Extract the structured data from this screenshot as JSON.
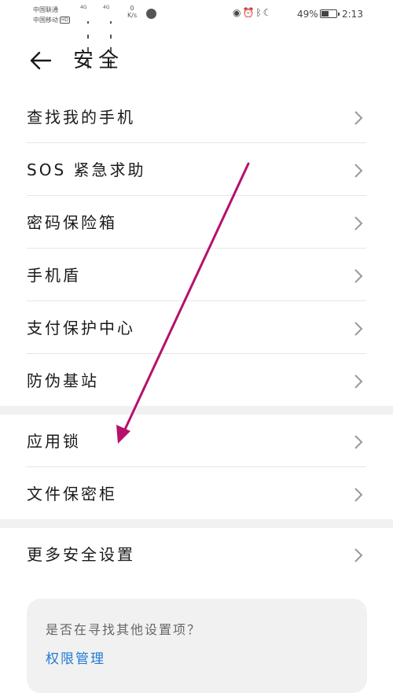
{
  "status_bar": {
    "carrier1": "中国联通",
    "carrier2": "中国移动",
    "hd": "HD",
    "network1": "4G",
    "network2": "4G",
    "speed_value": "0",
    "speed_unit": "K/s",
    "icons": [
      "eye-icon",
      "alarm-icon",
      "bluetooth-icon",
      "moon-icon"
    ],
    "battery_percent": "49%",
    "battery_level": 0.49,
    "time": "2:13"
  },
  "header": {
    "title": "安全"
  },
  "items": [
    {
      "label": "查找我的手机"
    },
    {
      "label": "SOS 紧急求助"
    },
    {
      "label": "密码保险箱"
    },
    {
      "label": "手机盾"
    },
    {
      "label": "支付保护中心"
    },
    {
      "label": "防伪基站"
    },
    {
      "label": "应用锁"
    },
    {
      "label": "文件保密柜"
    },
    {
      "label": "更多安全设置"
    }
  ],
  "suggestion": {
    "question": "是否在寻找其他设置项？",
    "link": "权限管理"
  },
  "colors": {
    "annotation_arrow": "#b5116c",
    "link": "#1f7ad6",
    "section_gap": "#f1f1f1"
  }
}
